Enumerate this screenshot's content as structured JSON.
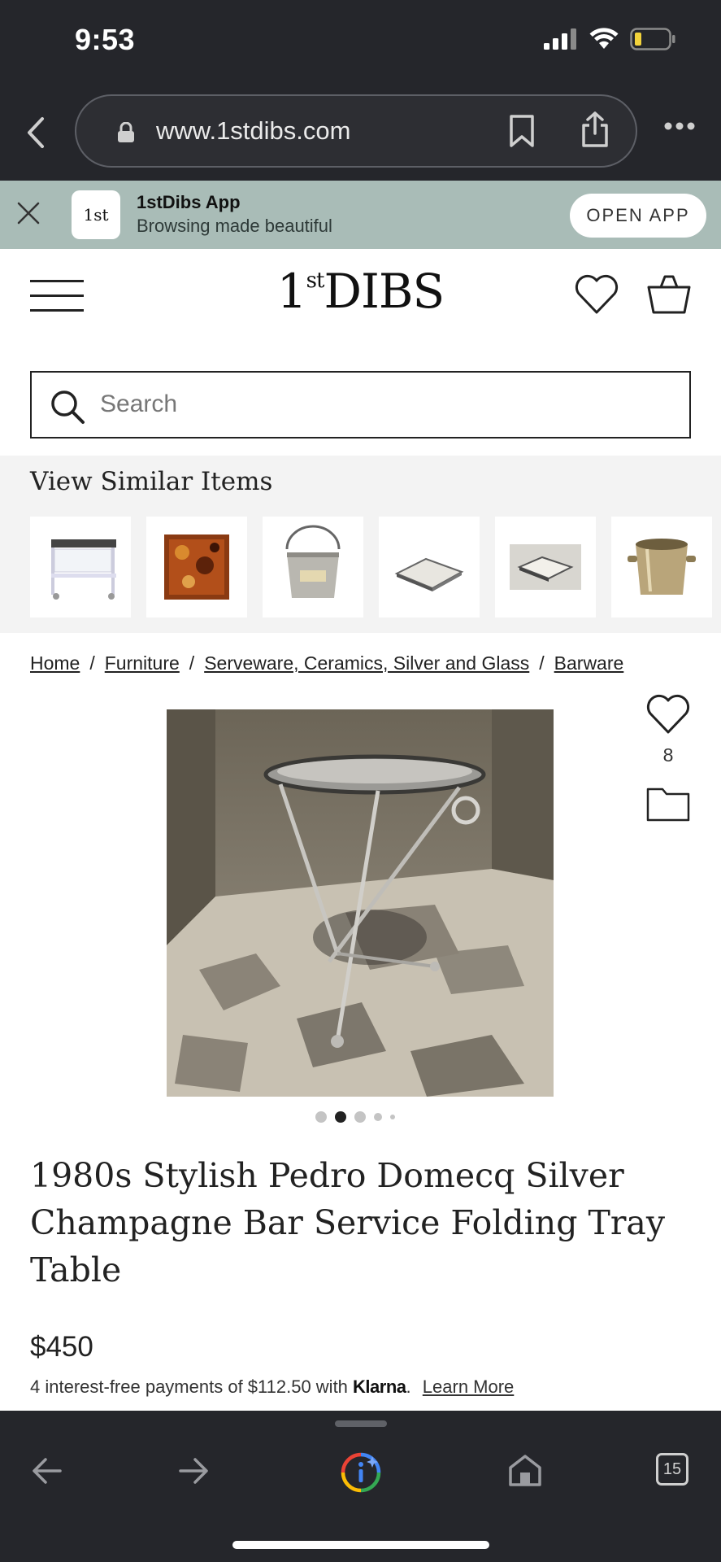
{
  "status_bar": {
    "time": "9:53"
  },
  "browser": {
    "url": "www.1stdibs.com"
  },
  "app_banner": {
    "app_name": "1stDibs App",
    "tagline": "Browsing made beautiful",
    "open_label": "OPEN APP",
    "logo_text": "1st"
  },
  "header": {
    "logo_main": "DIBS",
    "logo_prefix": "1",
    "logo_sup": "st"
  },
  "search": {
    "placeholder": "Search"
  },
  "similar": {
    "title": "View Similar Items",
    "items": [
      "acrylic-bar-cart",
      "amber-tray",
      "champagne-bucket",
      "silver-tray",
      "silver-tray-set",
      "ice-bucket"
    ]
  },
  "breadcrumb": {
    "items": [
      "Home",
      "Furniture",
      "Serveware, Ceramics, Silver and Glass",
      "Barware"
    ],
    "separator": "/"
  },
  "product": {
    "favorite_count": "8",
    "title": "1980s Stylish Pedro Domecq Silver Champagne Bar Service Folding Tray Table",
    "price": "$450",
    "installments_text": "4 interest-free payments of $112.50 with",
    "installments_brand": "Klarna",
    "installments_brand_suffix": ".",
    "learn_more": "Learn More",
    "image_index": 2,
    "image_count": 5
  },
  "bottom_bar": {
    "tabs_count": "15"
  },
  "colors": {
    "chrome": "#25262b",
    "banner": "#a9bcb7",
    "similar_bg": "#f3f3f3"
  }
}
